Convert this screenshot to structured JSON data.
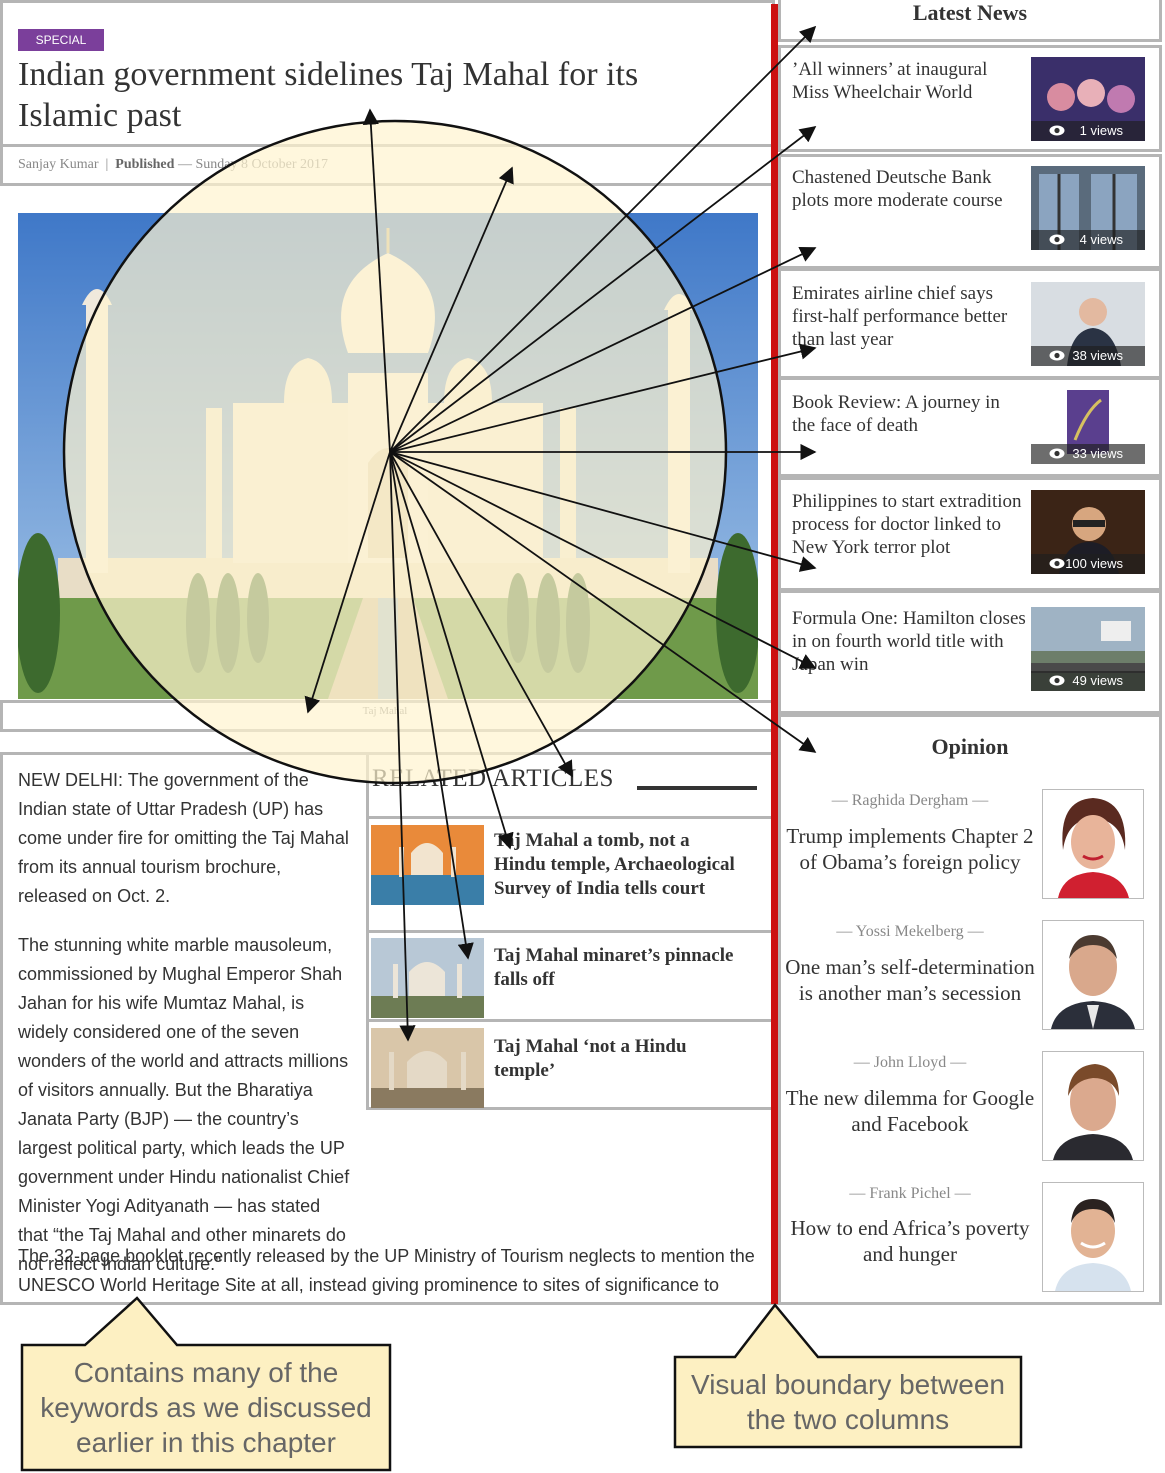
{
  "article": {
    "badge": "SPECIAL",
    "headline": "Indian government sidelines Taj Mahal for its Islamic past",
    "author": "Sanjay Kumar",
    "separator": "|",
    "published_label": "Published",
    "date": "— Sunday 8 October 2017",
    "photo_caption": "Taj Mahal",
    "paragraphs": [
      "NEW DELHI: The government of the Indian state of Uttar Pradesh (UP) has come under fire for omitting the Taj Mahal from its annual tourism brochure, released on Oct. 2.",
      "The stunning white marble mausoleum, commissioned by Mughal Emperor Shah Jahan for his wife Mumtaz Mahal, is widely considered one of the seven wonders of the world and attracts millions of visitors annually. But the Bharatiya Janata Party (BJP) — the country’s largest political party, which leads the UP government under Hindu nationalist Chief Minister Yogi Adityanath — has stated that “the Taj Mahal and other minarets do not reflect Indian culture.”",
      "The 32-page booklet recently released by the UP Ministry of Tourism neglects to mention the UNESCO World Heritage Site at all, instead giving prominence to sites of significance to"
    ]
  },
  "related": {
    "title": "RELATED ARTICLES",
    "items": [
      {
        "title": "Taj Mahal a tomb, not a Hindu temple, Archaeological Survey of India tells court"
      },
      {
        "title": "Taj Mahal minaret’s pinnacle falls off"
      },
      {
        "title": "Taj Mahal ‘not a Hindu temple’"
      }
    ]
  },
  "latest_news": {
    "title": "Latest News",
    "items": [
      {
        "title": "’All winners’ at inaugural Miss Wheelchair World",
        "views": "1 views"
      },
      {
        "title": "Chastened Deutsche Bank plots more moderate course",
        "views": "4 views"
      },
      {
        "title": "Emirates airline chief says first-half performance better than last year",
        "views": "38 views"
      },
      {
        "title": "Book Review: A journey in the face of death",
        "views": "33 views"
      },
      {
        "title": "Philippines to start extradition process for doctor linked to New York terror plot",
        "views": "100 views"
      },
      {
        "title": "Formula One: Hamilton closes in on fourth world title with Japan win",
        "views": "49 views"
      }
    ]
  },
  "opinion": {
    "title": "Opinion",
    "items": [
      {
        "author": "— Raghida Dergham —",
        "title": "Trump implements Chapter 2 of Obama’s foreign policy"
      },
      {
        "author": "— Yossi Mekelberg —",
        "title": "One man’s self-determination is another man’s secession"
      },
      {
        "author": "— John Lloyd —",
        "title": "The new dilemma for Google and Facebook"
      },
      {
        "author": "— Frank Pichel —",
        "title": "How to end Africa’s poverty and hunger"
      }
    ]
  },
  "annotations": {
    "left_callout": "Contains many of the keywords as we discussed earlier in this chapter",
    "right_callout": "Visual boundary between the two columns"
  },
  "colors": {
    "badge": "#7b3f9b",
    "boundary_line": "#cc1111",
    "callout_fill": "#fdf0c2",
    "circle_fill": "#fff4cf",
    "border": "#b5b5b5"
  }
}
